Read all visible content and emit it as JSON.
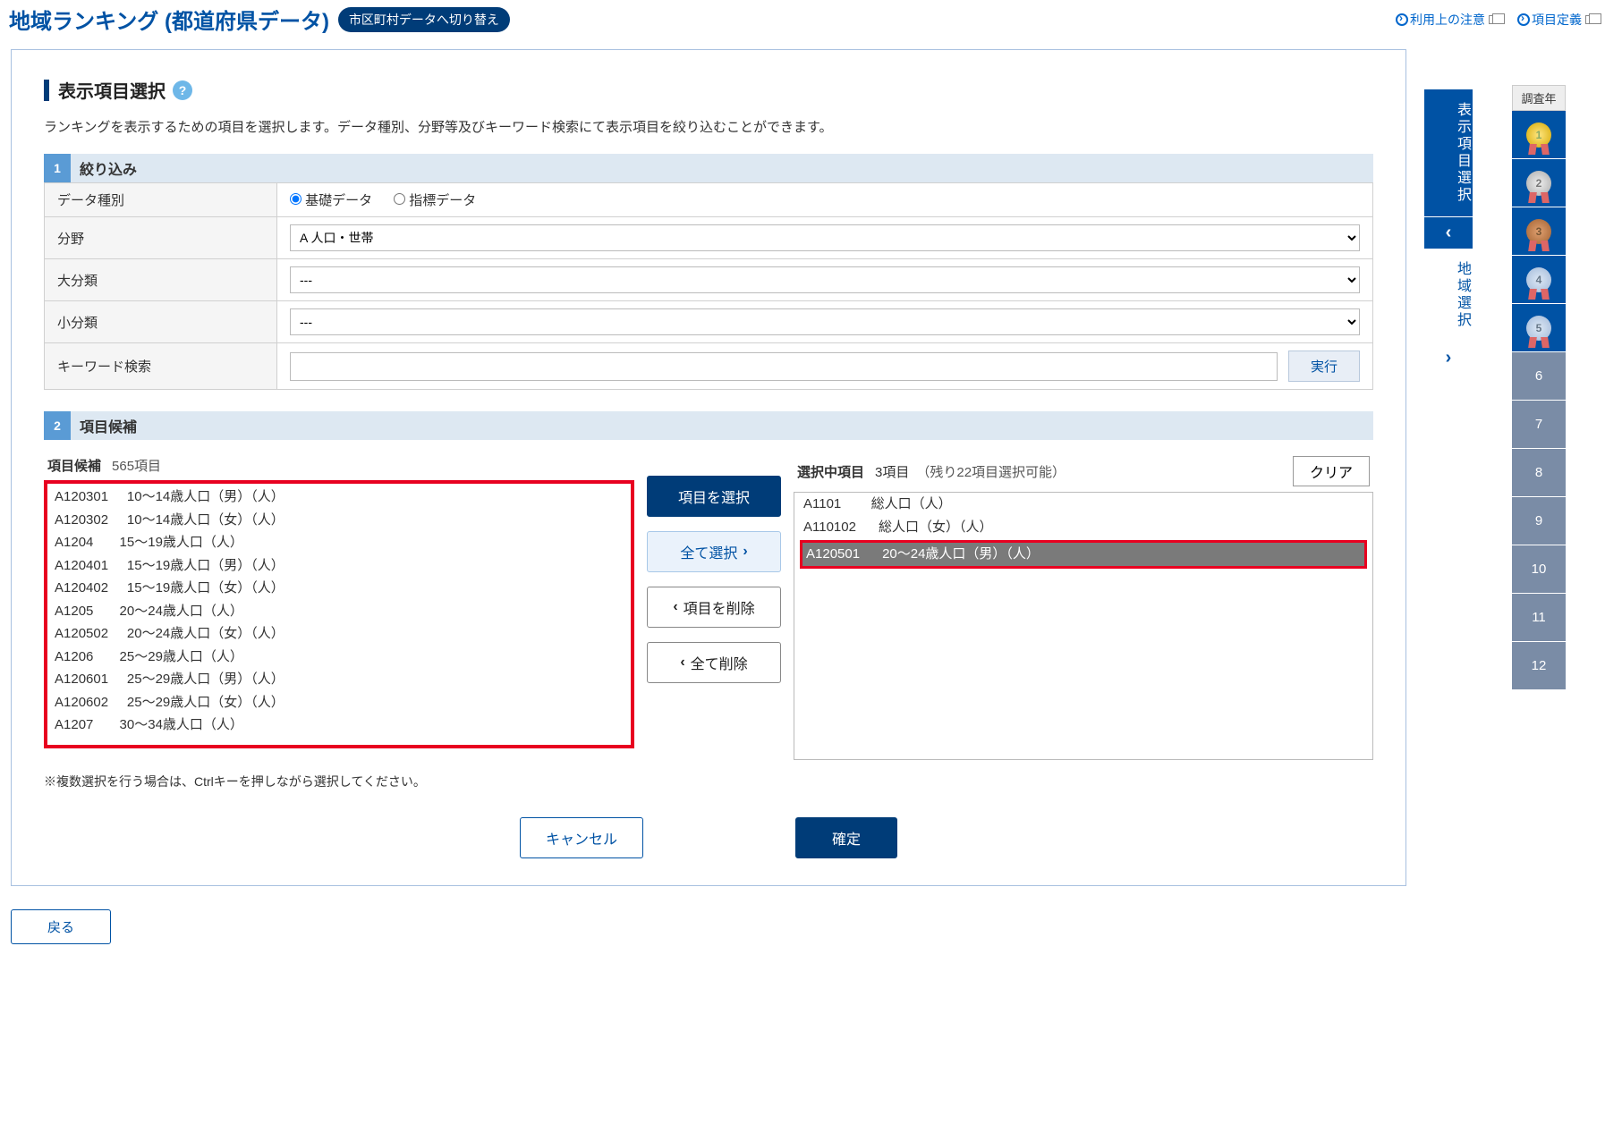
{
  "header": {
    "title": "地域ランキング (都道府県データ)",
    "switch": "市区町村データへ切り替え",
    "link_notice": "利用上の注意",
    "link_def": "項目定義"
  },
  "section": {
    "title": "表示項目選択",
    "help": "?",
    "desc": "ランキングを表示するための項目を選択します。データ種別、分野等及びキーワード検索にて表示項目を絞り込むことができます。"
  },
  "filter": {
    "step1": "1",
    "head": "絞り込み",
    "labels": {
      "datatype": "データ種別",
      "field": "分野",
      "major": "大分類",
      "minor": "小分類",
      "keyword": "キーワード検索"
    },
    "radio_basic": "基礎データ",
    "radio_indicator": "指標データ",
    "field_value": "A 人口・世帯",
    "major_value": "---",
    "minor_value": "---",
    "exec": "実行"
  },
  "candidates": {
    "step2": "2",
    "head": "項目候補",
    "list_title": "項目候補",
    "count": "565項目",
    "items": [
      {
        "code": "A120301",
        "label": "10～14歳人口（男）（人）"
      },
      {
        "code": "A120302",
        "label": "10～14歳人口（女）（人）"
      },
      {
        "code": "A1204",
        "label": "15～19歳人口（人）"
      },
      {
        "code": "A120401",
        "label": "15～19歳人口（男）（人）"
      },
      {
        "code": "A120402",
        "label": "15～19歳人口（女）（人）"
      },
      {
        "code": "A1205",
        "label": "20～24歳人口（人）"
      },
      {
        "code": "A120502",
        "label": "20～24歳人口（女）（人）"
      },
      {
        "code": "A1206",
        "label": "25～29歳人口（人）"
      },
      {
        "code": "A120601",
        "label": "25～29歳人口（男）（人）"
      },
      {
        "code": "A120602",
        "label": "25～29歳人口（女）（人）"
      },
      {
        "code": "A1207",
        "label": "30～34歳人口（人）"
      }
    ]
  },
  "selected": {
    "title": "選択中項目",
    "count": "3項目",
    "remain": "（残り22項目選択可能）",
    "clear": "クリア",
    "items": [
      {
        "code": "A1101",
        "label": "総人口（人）",
        "sel": false
      },
      {
        "code": "A110102",
        "label": "総人口（女）（人）",
        "sel": false
      },
      {
        "code": "A120501",
        "label": "20～24歳人口（男）（人）",
        "sel": true
      }
    ]
  },
  "mid_buttons": {
    "select": "項目を選択",
    "select_all": "全て選択",
    "remove": "項目を削除",
    "remove_all": "全て削除"
  },
  "note": "※複数選択を行う場合は、Ctrlキーを押しながら選択してください。",
  "actions": {
    "cancel": "キャンセル",
    "confirm": "確定"
  },
  "back": "戻る",
  "side": {
    "tab1": "表示項目選択",
    "tab2": "地域選択"
  },
  "ranks": {
    "head": "調査年",
    "medals": [
      "1",
      "2",
      "3",
      "4",
      "5"
    ],
    "rows": [
      "6",
      "7",
      "8",
      "9",
      "10",
      "11",
      "12"
    ]
  }
}
